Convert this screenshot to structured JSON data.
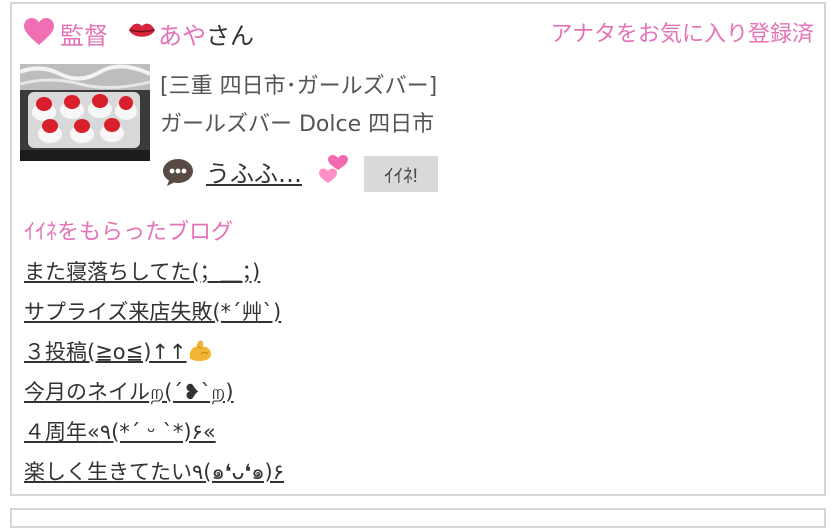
{
  "header": {
    "cast_label": "監督",
    "cast_name_pink": "あや",
    "cast_name_suffix": "さん",
    "favorite_status": "アナタをお気に入り登録済"
  },
  "shop": {
    "area": "[三重 四日市･ガールズバー]",
    "name": "ガールズバー Dolce 四日市"
  },
  "comment": {
    "text": "うふふ…"
  },
  "iine_button": {
    "label": "ｲｲﾈ!"
  },
  "blog_section": {
    "title": "ｲｲﾈをもらったブログ",
    "items": [
      {
        "title": "また寝落ちしてた(；＿；)"
      },
      {
        "title": "サプライズ来店失敗(*´艸`)"
      },
      {
        "title": "３投稿(≧o≦)↑↑"
      },
      {
        "title": "今月のネイルற(´❥`ற)"
      },
      {
        "title": "４周年«٩(*´ ᵕ `*)۶«"
      },
      {
        "title": "楽しく生きてたい٩(๑❛ᴗ❛๑)۶"
      }
    ]
  },
  "colors": {
    "accent_pink": "#e573b8",
    "border_gray": "#d6d6d6",
    "button_gray": "#d9d9d9"
  },
  "icons": {
    "heart": "pink-heart-icon",
    "lips": "kiss-lips-icon",
    "comment": "speech-balloon-icon",
    "twin_hearts": "two-hearts-icon",
    "flexed_biceps": "flexed-biceps-icon"
  }
}
